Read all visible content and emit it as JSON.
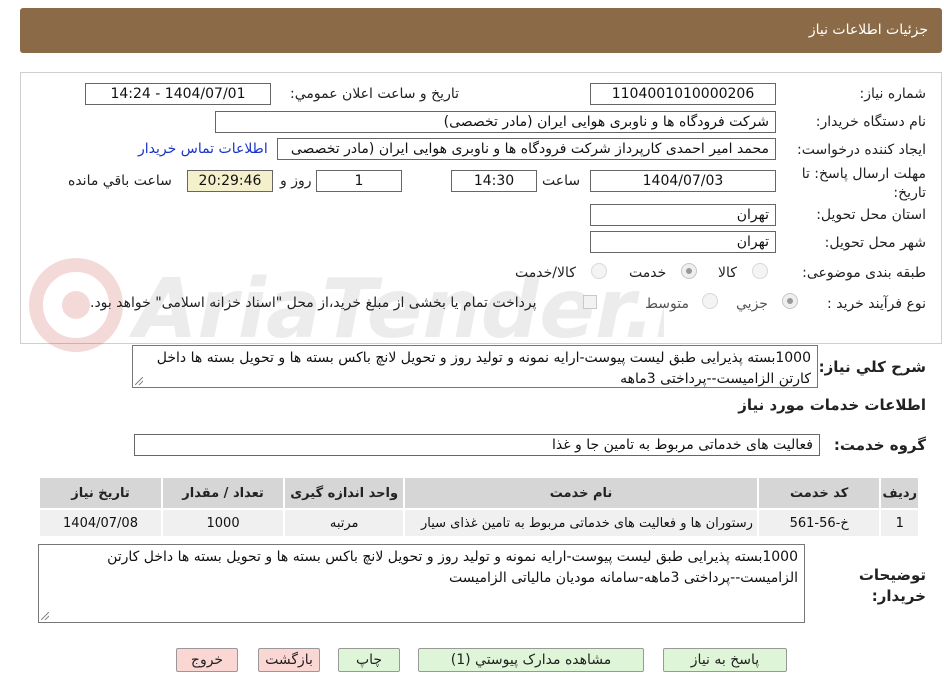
{
  "header": {
    "title": "جزئیات اطلاعات نیاز"
  },
  "form": {
    "need_number_label": "شماره نیاز:",
    "need_number": "1104001010000206",
    "announce_label": "تاریخ و ساعت اعلان عمومي:",
    "announce_value": "1404/07/01 - 14:24",
    "buyer_org_label": "نام دستگاه خريدار:",
    "buyer_org": "شرکت فرودگاه ها و ناوبری هوايی ايران (مادر تخصصی)",
    "requester_label": "ايجاد كننده درخواست:",
    "requester": "محمد امیر احمدی کارپرداز شرکت فرودگاه ها و ناوبری هوایی ایران (مادر تخصصی",
    "contact_link": "اطلاعات تماس خريدار",
    "deadline_label": "مهلت ارسال پاسخ: تا تاریخ:",
    "deadline_date": "1404/07/03",
    "time_label": "ساعت",
    "deadline_time": "14:30",
    "days_value": "1",
    "days_label": "روز و",
    "remaining_time": "20:29:46",
    "remaining_label": "ساعت باقي مانده",
    "province_label": "استان محل تحويل:",
    "province": "تهران",
    "city_label": "شهر محل تحويل:",
    "city": "تهران",
    "category_label": "طبقه بندی موضوعی:",
    "category_options": [
      "كالا",
      "خدمت",
      "كالا/خدمت"
    ],
    "process_label": "نوع فرآيند خريد :",
    "process_options": [
      "جزيي",
      "متوسط"
    ],
    "payment_note": "پرداخت تمام يا بخشی از مبلغ خريد،از محل \"اسناد خزانه اسلامی\" خواهد بود."
  },
  "summary": {
    "label": "شرح كلي نياز:",
    "text": "1000بسته پذیرایی طبق لیست پیوست-ارایه نمونه و تولید روز و تحویل لانچ باکس بسته ها و تحویل بسته ها داخل کارتن الزامیست--پرداختی 3ماهه"
  },
  "services": {
    "section_title": "اطلاعات خدمات مورد نياز",
    "group_label": "گروه خدمت:",
    "group_value": "فعالیت های خدماتی مربوط به تامین جا و غذا",
    "columns": [
      "رديف",
      "کد خدمت",
      "نام خدمت",
      "واحد اندازه گيری",
      "تعداد / مقدار",
      "تاريخ نياز"
    ],
    "rows": [
      [
        "1",
        "خ-56-561",
        "رستوران ها و فعالیت های خدماتی مربوط به تامین غذای سیار",
        "مرتبه",
        "1000",
        "1404/07/08"
      ]
    ]
  },
  "buyer_notes": {
    "label": "توضيحات خريدار:",
    "text": "1000بسته پذیرایی طبق لیست پیوست-ارایه نمونه و تولید روز و تحویل لانچ باکس بسته ها و تحویل بسته ها داخل کارتن الزامیست--پرداختی 3ماهه-سامانه مودیان مالیاتی الزامیست"
  },
  "buttons": {
    "respond": "پاسخ به نياز",
    "view_docs": "مشاهده مدارک پيوستي (1)",
    "print": "چاپ",
    "back": "بازگشت",
    "exit": "خروج"
  },
  "watermark": {
    "text": "AriaTender.neT"
  }
}
